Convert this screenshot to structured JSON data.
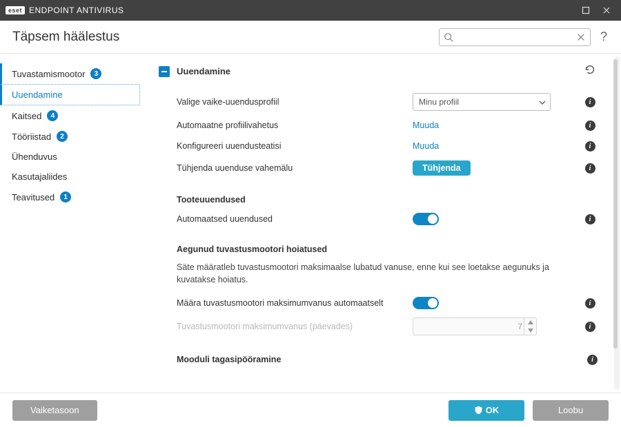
{
  "titlebar": {
    "brand_badge": "eset",
    "brand_text": "ENDPOINT ANTIVIRUS"
  },
  "header": {
    "title": "Täpsem häälestus",
    "search_placeholder": ""
  },
  "sidebar": {
    "items": [
      {
        "label": "Tuvastamismootor",
        "badge": "3"
      },
      {
        "label": "Uuendamine",
        "badge": ""
      },
      {
        "label": "Kaitsed",
        "badge": "4"
      },
      {
        "label": "Tööriistad",
        "badge": "2"
      },
      {
        "label": "Ühenduvus",
        "badge": ""
      },
      {
        "label": "Kasutajaliides",
        "badge": ""
      },
      {
        "label": "Teavitused",
        "badge": "1"
      }
    ]
  },
  "content": {
    "section_title": "Uuendamine",
    "rows": {
      "profile_label": "Valige vaike-uuendusprofiil",
      "profile_value": "Minu profiil",
      "auto_switch_label": "Automaatne profiilivahetus",
      "auto_switch_link": "Muuda",
      "notify_label": "Konfigureeri uuendusteatisi",
      "notify_link": "Muuda",
      "clear_label": "Tühjenda uuenduse vahemälu",
      "clear_button": "Tühjenda"
    },
    "product_updates": {
      "heading": "Tooteuuendused",
      "auto_label": "Automaatsed uuendused"
    },
    "engine_alerts": {
      "heading": "Aegunud tuvastusmootori hoiatused",
      "desc": "Säte määratleb tuvastusmootori maksimaalse lubatud vanuse, enne kui see loetakse aegunuks ja kuvatakse hoiatus.",
      "auto_max_label": "Määra tuvastusmootori maksimumvanus automaatselt",
      "max_age_label": "Tuvastusmootori maksimumvanus (päevades)",
      "max_age_value": "7"
    },
    "rollback": {
      "heading": "Mooduli tagasipööramine"
    }
  },
  "footer": {
    "defaults": "Vaiketasoon",
    "ok": "OK",
    "cancel": "Loobu"
  }
}
